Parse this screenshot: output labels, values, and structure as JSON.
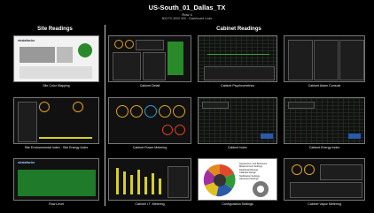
{
  "header": {
    "title": "US-South_01_Dallas_TX",
    "subtitle": "Row 4",
    "subtitle2": "800 FO 4000 000 · Dashboard Links"
  },
  "sections": {
    "site": "Site Readings",
    "cabinet": "Cabinet Readings"
  },
  "tiles": {
    "site_color_mapping": "Site Color Mapping",
    "cabinet_detail": "Cabinet Detail",
    "cabinet_psychrometrics": "Cabinet Psychrometrics",
    "cabinet_alarm_console": "Cabinet Alarm Console",
    "site_env_energy": "Site Environmental Index · Site Energy Index",
    "cabinet_power_metering": "Cabinet Power Metering",
    "cabinet_index": "Cabinet Index",
    "cabinet_energy_index": "Cabinet Energy Index",
    "row_level": "Row Level",
    "cabinet_it_metering": "Cabinet I.T. Metering",
    "configuration_settings": "Configuration Settings",
    "cabinet_vapor_metering": "Cabinet Vapor Metering"
  },
  "thumb_text": {
    "brand": "stratafactor",
    "config_lines": [
      "Appearance and Behaviour",
      "Measurement Settings",
      "Dashboard Range",
      "Calibrate Range",
      "Notification Settings",
      "Advanced Settings"
    ]
  },
  "colors": {
    "background": "#000000",
    "accent_orange": "#e0a020",
    "accent_green": "#2a8a2a",
    "accent_blue": "#2a5aa8",
    "accent_yellow": "#d8d020"
  }
}
